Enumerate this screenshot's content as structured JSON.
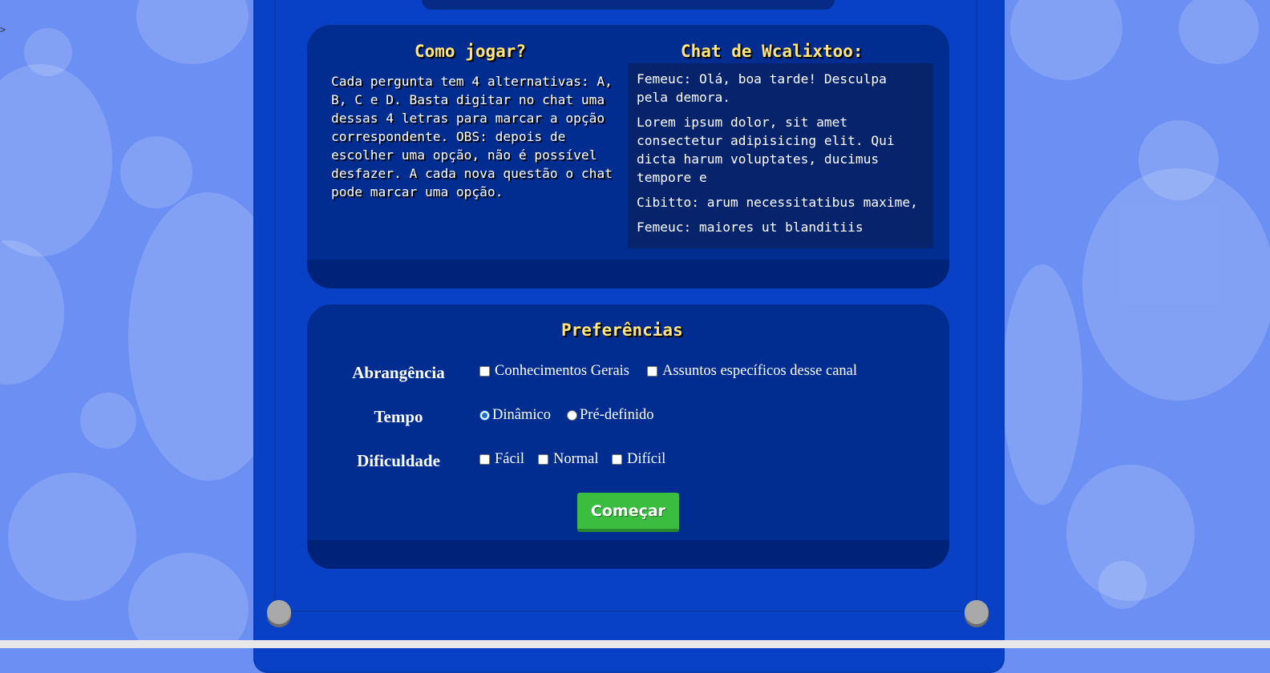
{
  "stray_char": ">",
  "how_to_play": {
    "title": "Como jogar?",
    "text": "Cada pergunta tem 4 alternativas: A, B, C e D. Basta digitar no chat uma dessas 4 letras para marcar a opção correspondente. OBS: depois de escolher uma opção, não é possível desfazer. A cada nova questão o chat pode marcar uma opção."
  },
  "chat": {
    "title": "Chat de Wcalixtoo:",
    "messages": [
      "Femeuc: Olá, boa tarde! Desculpa pela demora.",
      "Lorem ipsum dolor, sit amet consectetur adipisicing elit. Qui dicta harum voluptates, ducimus tempore e",
      "Cibitto: arum necessitatibus maxime,",
      "Femeuc: maiores ut blanditiis"
    ]
  },
  "preferences": {
    "title": "Preferências",
    "scope": {
      "label": "Abrangência",
      "options": [
        {
          "label": "Conhecimentos Gerais",
          "checked": false
        },
        {
          "label": "Assuntos específicos desse canal",
          "checked": false
        }
      ]
    },
    "time": {
      "label": "Tempo",
      "options": [
        {
          "label": "Dinâmico",
          "checked": true
        },
        {
          "label": "Pré-definido",
          "checked": false
        }
      ]
    },
    "difficulty": {
      "label": "Dificuldade",
      "options": [
        {
          "label": "Fácil",
          "checked": false
        },
        {
          "label": "Normal",
          "checked": false
        },
        {
          "label": "Difícil",
          "checked": false
        }
      ]
    },
    "start_button": "Começar"
  },
  "colors": {
    "background": "#6b8ff3",
    "board": "#0841c6",
    "panel": "#002d8f",
    "heading": "#ffe57a",
    "button": "#3bbd3f"
  }
}
